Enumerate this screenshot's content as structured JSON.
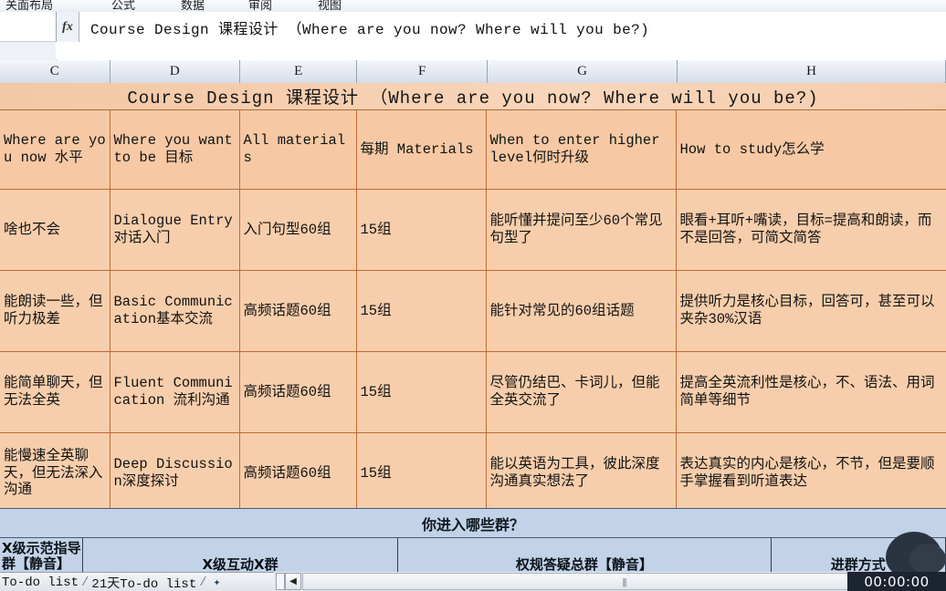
{
  "menu": {
    "items": [
      "关面布局",
      "公式",
      "数据",
      "审阅",
      "视图"
    ]
  },
  "formula_bar": {
    "fx_label": "fx",
    "content": "Course Design 课程设计 （Where are you now? Where will you be?)"
  },
  "columns": [
    "C",
    "D",
    "E",
    "F",
    "G",
    "H"
  ],
  "sheet": {
    "title": "Course Design 课程设计 （Where are you now? Where will you be?)",
    "headers": [
      "Where are you now 水平",
      "Where you want to be 目标",
      "All materials",
      "每期 Materials",
      "When to enter higher level何时升级",
      "How to study怎么学"
    ],
    "rows": [
      [
        "啥也不会",
        "Dialogue Entry对话入门",
        "入门句型60组",
        "15组",
        "能听懂并提问至少60个常见句型了",
        "眼看+耳听+嘴读，目标=提高和朗读，而不是回答，可简文简答"
      ],
      [
        "能朗读一些，但听力极差",
        "Basic Communication基本交流",
        "高频话题60组",
        "15组",
        "能针对常见的60组话题",
        "提供听力是核心目标，回答可，甚至可以夹杂30%汉语"
      ],
      [
        "能简单聊天，但无法全英",
        "Fluent Communication 流利沟通",
        "高频话题60组",
        "15组",
        "尽管仍结巴、卡词儿，但能全英交流了",
        "提高全英流利性是核心，不、语法、用词简单等细节"
      ],
      [
        "能慢速全英聊天，但无法深入沟通",
        "Deep Discussion深度探讨",
        "高频话题60组",
        "15组",
        "能以英语为工具，彼此深度沟通真实想法了",
        "表达真实的内心是核心，不节，但是要顺手掌握看到听道表达"
      ]
    ]
  },
  "groups_section": {
    "title": "你进入哪些群？",
    "cells": [
      "X级示范指导群【静音】",
      "X级互动X群",
      "权规答疑总群【静音】",
      "进群方式"
    ]
  },
  "bottom": {
    "sheet_tabs": [
      "To-do list",
      "21天To-do list"
    ],
    "new_sheet_icon": "new-sheet-icon",
    "timer": "00:00:00",
    "scroll_grip": "||||"
  }
}
